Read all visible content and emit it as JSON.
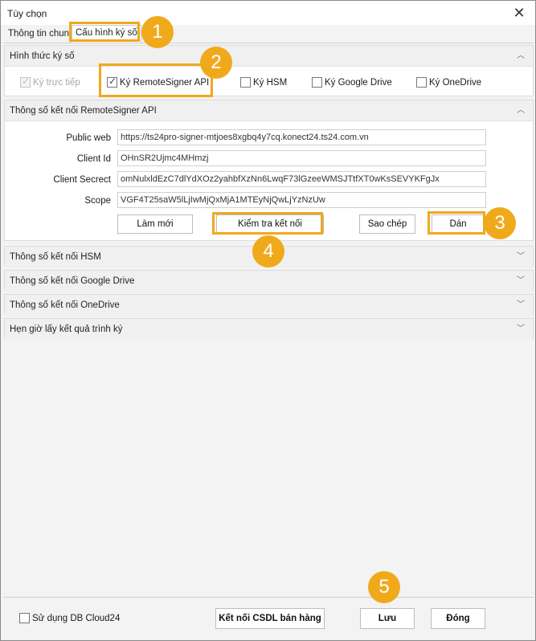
{
  "window": {
    "title": "Tùy chọn",
    "close_glyph": "✕"
  },
  "tabs": [
    {
      "label": "Thông tin chung",
      "active": false
    },
    {
      "label": "Cấu hình ký số",
      "active": true
    }
  ],
  "signing_method": {
    "header": "Hình thức ký số",
    "options": [
      {
        "label": "Ký trực tiếp",
        "checked": true,
        "enabled": false
      },
      {
        "label": "Ký RemoteSigner API",
        "checked": true,
        "enabled": true
      },
      {
        "label": "Ký HSM",
        "checked": false,
        "enabled": true
      },
      {
        "label": "Ký Google Drive",
        "checked": false,
        "enabled": true
      },
      {
        "label": "Ký OneDrive",
        "checked": false,
        "enabled": true
      }
    ]
  },
  "remote_signer": {
    "header": "Thông số kết nối RemoteSigner API",
    "fields": [
      {
        "label": "Public web",
        "value": "https://ts24pro-signer-mtjoes8xgbq4y7cq.konect24.ts24.com.vn"
      },
      {
        "label": "Client Id",
        "value": "OHnSR2Ujmc4MHmzj"
      },
      {
        "label": "Client Secrect",
        "value": "omNulxldEzC7dlYdXOz2yahbfXzNn6LwqF73lGzeeWMSJTtfXT0wKsSEVYKFgJx"
      },
      {
        "label": "Scope",
        "value": "VGF4T25saW5lLjIwMjQxMjA1MTEyNjQwLjYzNzUw"
      }
    ],
    "buttons": {
      "refresh": "Làm mới",
      "test": "Kiểm tra kết nối",
      "copy": "Sao chép",
      "paste": "Dán"
    }
  },
  "sections": [
    {
      "header": "Thông số kết nối HSM"
    },
    {
      "header": "Thông số kết nối Google Drive"
    },
    {
      "header": "Thông số kết nối OneDrive"
    },
    {
      "header": "Hẹn giờ lấy kết quả trình ký"
    }
  ],
  "footer": {
    "use_cloud_label": "Sử dụng DB Cloud24",
    "use_cloud_checked": false,
    "connect_db": "Kết nối CSDL bán hàng",
    "save": "Lưu",
    "close": "Đóng"
  },
  "step_badges": [
    "1",
    "2",
    "3",
    "4",
    "5"
  ],
  "colors": {
    "highlight": "#f0a81c",
    "badge": "#f1a91c"
  },
  "icons": {
    "expanded": "chevron-up-icon",
    "collapsed": "chevron-down-icon",
    "check": "✓"
  }
}
